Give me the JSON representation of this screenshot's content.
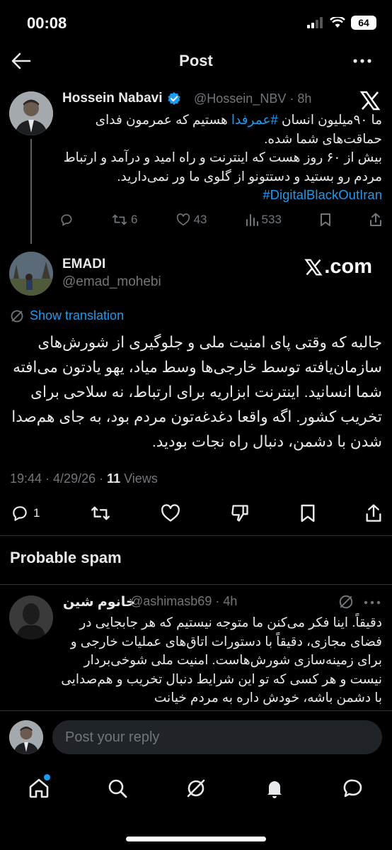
{
  "status_bar": {
    "time": "00:08",
    "battery": "64"
  },
  "header": {
    "title": "Post"
  },
  "parent_tweet": {
    "name": "Hossein Nabavi",
    "handle": "@Hossein_NBV · 8h",
    "text_line1_pre": "ما ۹۰میلیون انسان",
    "text_line1_hashtag": " #عمرفدا",
    "text_line1_post": " هستیم که عمرمون فدای حماقت‌های شما شده.",
    "text_line2": "بیش از ۶۰ روز هست که اینترنت و راه امید و درآمد و ارتباط مردم رو بستید و دستتونو از گلوی ما ور نمی‌دارید.",
    "hashtag2": "#DigitalBlackOutIran",
    "stats": {
      "retweets": "6",
      "likes": "43",
      "views": "533"
    }
  },
  "main_tweet": {
    "name": "EMADI",
    "handle": "@emad_mohebi",
    "watermark": ".com",
    "show_translation": "Show translation",
    "text": "جالبه که وقتی پای امنیت ملی و جلوگیری از شورش‌های سازمان‌یافته توسط خارجی‌ها وسط میاد، یهو یادتون می‌افته شما انسانید. اینترنت ابزاریه برای ارتباط، نه سلاحی برای تخریب کشور. اگه واقعا دغدغه‌تون مردم بود، به جای هم‌صدا شدن با دشمن، دنبال راه نجات بودید.",
    "timestamp": "19:44 · 4/29/26 · ",
    "views_count": "11",
    "views_label": " Views",
    "reply_count": "1"
  },
  "spam_section": {
    "title": "Probable spam",
    "reply": {
      "name": "خانوم شین",
      "handle": "@ashimasb69 · 4h",
      "text": "دقیقاً. اینا فکر می‌کنن ما متوجه نیستیم که هر جابجایی در فضای مجازی، دقیقاً با دستورات اتاق‌های عملیات خارجی و برای زمینه‌سازی شورش‌هاست. امنیت ملی شوخی‌بردار نیست و هر کسی که تو این شرایط دنبال تخریب و هم‌صدایی با دشمن باشه، خودش داره به مردم خیانت"
    }
  },
  "reply_bar": {
    "placeholder": "Post your reply"
  },
  "colors": {
    "accent": "#1d9bf0",
    "background": "#000000",
    "muted": "#71767b",
    "verified": "#1d9bf0"
  },
  "icons": [
    "back-arrow-icon",
    "more-icon",
    "verified-badge-icon",
    "x-logo-icon",
    "reply-icon",
    "retweet-icon",
    "like-icon",
    "views-icon",
    "bookmark-icon",
    "share-icon",
    "translate-icon",
    "dislike-icon",
    "grok-icon",
    "home-icon",
    "search-icon",
    "bell-icon",
    "messages-icon"
  ]
}
